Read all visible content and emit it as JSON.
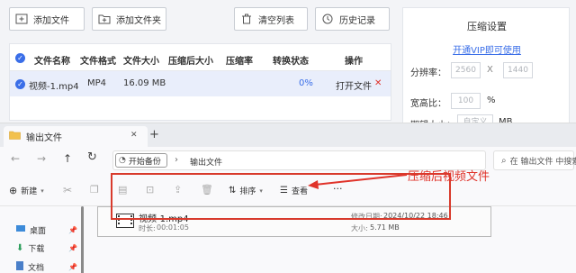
{
  "app": {
    "toolbar": {
      "add_file": "添加文件",
      "add_folder": "添加文件夹",
      "clear_list": "清空列表",
      "history": "历史记录"
    },
    "table": {
      "headers": [
        "文件名称",
        "文件格式",
        "文件大小",
        "压缩后大小",
        "压缩率",
        "转换状态",
        "操作"
      ],
      "rows": [
        {
          "name": "视频-1.mp4",
          "format": "MP4",
          "size": "16.09 MB",
          "compressed_size": "",
          "ratio": "",
          "status": "0%",
          "open": "打开文件",
          "delete": "✕"
        }
      ]
    },
    "settings": {
      "title": "压缩设置",
      "vip_link": "开通VIP即可使用",
      "resolution_label": "分辨率：",
      "width": "2560",
      "x_sep": "X",
      "height": "1440",
      "aspect_label": "宽高比：",
      "aspect_value": "100",
      "aspect_unit": "%",
      "size_label": "期望大小：",
      "size_value": "自定义",
      "size_unit": "MB"
    }
  },
  "explorer": {
    "tab_title": "输出文件",
    "tab_close": "✕",
    "new_tab": "+",
    "breadcrumb_root": "开始备份",
    "breadcrumb_sep": "›",
    "breadcrumb_current": "输出文件",
    "search_placeholder": "在 输出文件 中搜索",
    "new_label": "新建",
    "sort_label": "排序",
    "view_label": "查看",
    "more": "···",
    "sidebar": [
      {
        "label": "桌面",
        "color": "#3d8bd9"
      },
      {
        "label": "下载",
        "color": "#2a9d5a"
      },
      {
        "label": "文档",
        "color": "#4a7fc9"
      }
    ],
    "file": {
      "name": "视频-1.mp4",
      "duration_label": "时长:",
      "duration": "00:01:05",
      "modified_label": "修改日期:",
      "modified": "2024/10/22 18:46",
      "size_label": "大小:",
      "size": "5.71 MB"
    },
    "annotation": "压缩后视频文件"
  },
  "colors": {
    "accent": "#3a6ee8",
    "annotation_red": "#e0332a",
    "folder_yellow": "#f2c14e"
  }
}
